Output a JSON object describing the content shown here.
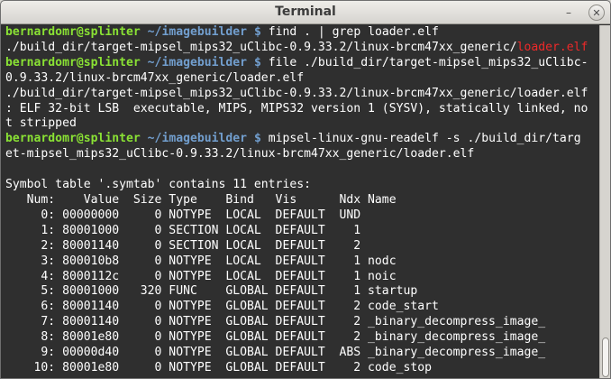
{
  "window": {
    "title": "Terminal",
    "minimize_glyph": "–",
    "close_glyph": "✕"
  },
  "colors": {
    "background": "#2f2f2f",
    "text": "#ffffff",
    "prompt_user": "#8ae234",
    "prompt_path": "#729fcf",
    "highlight": "#ef2929"
  },
  "terminal": {
    "lines": [
      {
        "type": "prompt",
        "user": "bernardomr@splinter",
        "path": "~/imagebuilder",
        "symbol": "$",
        "cmd": "find . | grep loader.elf"
      },
      {
        "type": "match",
        "prefix": "./build_dir/target-mipsel_mips32_uClibc-0.9.33.2/linux-brcm47xx_generic/",
        "match": "loader.elf"
      },
      {
        "type": "prompt",
        "user": "bernardomr@splinter",
        "path": "~/imagebuilder",
        "symbol": "$",
        "cmd": "file ./build_dir/target-mipsel_mips32_uClibc-"
      },
      {
        "type": "text",
        "text": "0.9.33.2/linux-brcm47xx_generic/loader.elf"
      },
      {
        "type": "text",
        "text": "./build_dir/target-mipsel_mips32_uClibc-0.9.33.2/linux-brcm47xx_generic/loader.elf"
      },
      {
        "type": "text",
        "text": ": ELF 32-bit LSB  executable, MIPS, MIPS32 version 1 (SYSV), statically linked, no"
      },
      {
        "type": "text",
        "text": "t stripped"
      },
      {
        "type": "prompt",
        "user": "bernardomr@splinter",
        "path": "~/imagebuilder",
        "symbol": "$",
        "cmd": "mipsel-linux-gnu-readelf -s ./build_dir/targ"
      },
      {
        "type": "text",
        "text": "et-mipsel_mips32_uClibc-0.9.33.2/linux-brcm47xx_generic/loader.elf"
      },
      {
        "type": "text",
        "text": ""
      },
      {
        "type": "text",
        "text": "Symbol table '.symtab' contains 11 entries:"
      },
      {
        "type": "text",
        "text": "   Num:    Value  Size Type    Bind   Vis      Ndx Name"
      },
      {
        "type": "text",
        "text": "     0: 00000000     0 NOTYPE  LOCAL  DEFAULT  UND "
      },
      {
        "type": "text",
        "text": "     1: 80001000     0 SECTION LOCAL  DEFAULT    1 "
      },
      {
        "type": "text",
        "text": "     2: 80001140     0 SECTION LOCAL  DEFAULT    2 "
      },
      {
        "type": "text",
        "text": "     3: 800010b8     0 NOTYPE  LOCAL  DEFAULT    1 nodc"
      },
      {
        "type": "text",
        "text": "     4: 8000112c     0 NOTYPE  LOCAL  DEFAULT    1 noic"
      },
      {
        "type": "text",
        "text": "     5: 80001000   320 FUNC    GLOBAL DEFAULT    1 startup"
      },
      {
        "type": "text",
        "text": "     6: 80001140     0 NOTYPE  GLOBAL DEFAULT    2 code_start"
      },
      {
        "type": "text",
        "text": "     7: 80001140     0 NOTYPE  GLOBAL DEFAULT    2 _binary_decompress_image_"
      },
      {
        "type": "text",
        "text": "     8: 80001e80     0 NOTYPE  GLOBAL DEFAULT    2 _binary_decompress_image_"
      },
      {
        "type": "text",
        "text": "     9: 00000d40     0 NOTYPE  GLOBAL DEFAULT  ABS _binary_decompress_image_"
      },
      {
        "type": "text",
        "text": "    10: 80001e80     0 NOTYPE  GLOBAL DEFAULT    2 code_stop"
      }
    ]
  }
}
